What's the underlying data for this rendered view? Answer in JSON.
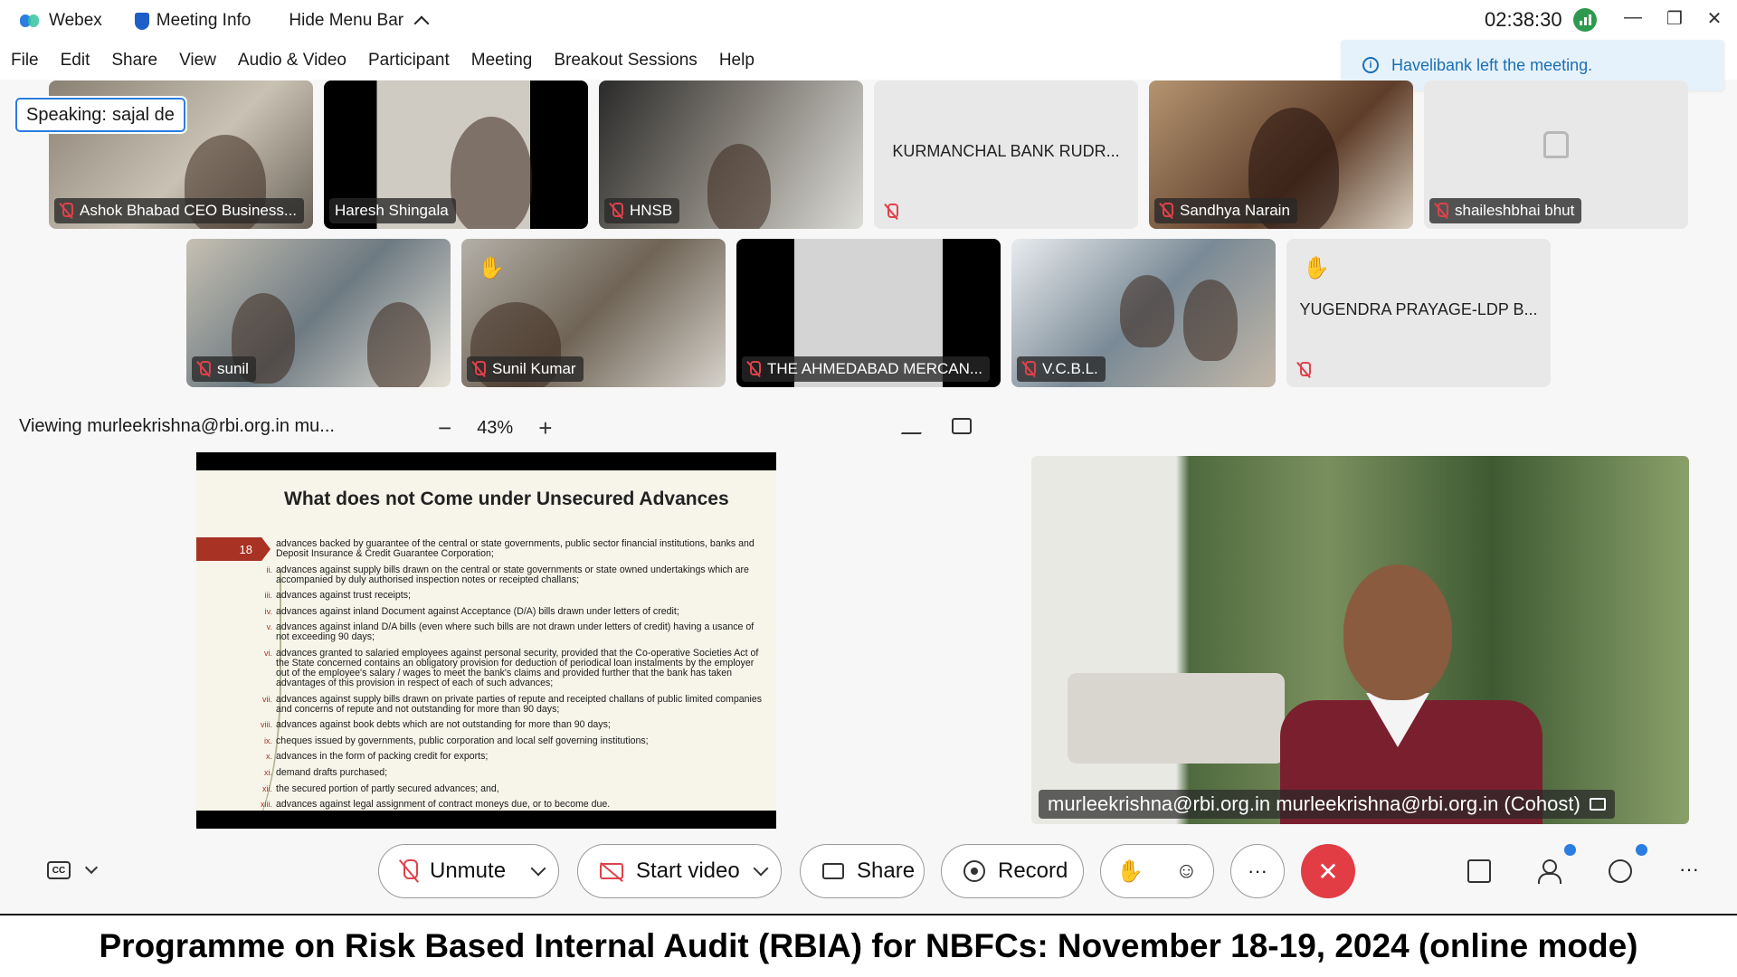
{
  "titlebar": {
    "app_name": "Webex",
    "meeting_info": "Meeting Info",
    "hide_menu": "Hide Menu Bar",
    "clock": "02:38:30"
  },
  "menu": [
    "File",
    "Edit",
    "Share",
    "View",
    "Audio & Video",
    "Participant",
    "Meeting",
    "Breakout Sessions",
    "Help"
  ],
  "toast": {
    "text": "Havelibank left the meeting."
  },
  "speaking": {
    "prefix": "Speaking:",
    "name": "sajal de"
  },
  "participants_row1": [
    {
      "name": "Ashok Bhabad CEO Business...",
      "muted": true
    },
    {
      "name": "Haresh Shingala",
      "muted": false
    },
    {
      "name": "HNSB",
      "muted": true
    },
    {
      "name": "KURMANCHAL BANK RUDR...",
      "muted": true
    },
    {
      "name": "Sandhya Narain",
      "muted": true
    },
    {
      "name": "shaileshbhai bhut",
      "muted": true
    }
  ],
  "participants_row2": [
    {
      "name": "sunil",
      "muted": true
    },
    {
      "name": "Sunil Kumar",
      "muted": true,
      "hand_raised": true
    },
    {
      "name": "THE AHMEDABAD MERCAN...",
      "muted": true
    },
    {
      "name": "V.C.B.L.",
      "muted": true
    },
    {
      "name": "YUGENDRA PRAYAGE-LDP B...",
      "muted": true,
      "hand_raised": true
    }
  ],
  "viewing": {
    "text": "Viewing murleekrishna@rbi.org.in mu...",
    "zoom": "43%",
    "minus": "−",
    "plus": "+"
  },
  "slide": {
    "title": "What does not Come under Unsecured Advances",
    "number": "18",
    "items": [
      {
        "roman": "",
        "text": "advances backed by guarantee of the central or state governments, public sector financial institutions, banks and Deposit Insurance & Credit Guarantee Corporation;"
      },
      {
        "roman": "ii.",
        "text": "advances against supply bills drawn on the central or state governments or state owned undertakings which are accompanied by duly authorised inspection notes or receipted challans;"
      },
      {
        "roman": "iii.",
        "text": "advances against trust receipts;"
      },
      {
        "roman": "iv.",
        "text": "advances against inland Document against Acceptance (D/A) bills drawn under letters of credit;"
      },
      {
        "roman": "v.",
        "text": "advances against inland D/A bills (even where such bills are not drawn under letters of credit) having a usance of not exceeding 90 days;"
      },
      {
        "roman": "vi.",
        "text": "advances granted to salaried employees against personal security, provided that the Co-operative Societies Act of the State concerned contains an obligatory provision for deduction of periodical loan instalments by the employer out of the employee's salary / wages to meet the bank's claims and provided further that the bank has taken advantages of this provision in respect of each of such advances;"
      },
      {
        "roman": "vii.",
        "text": "advances against supply bills drawn on private parties of repute and receipted challans of public limited companies and concerns of repute and not outstanding for more than 90 days;"
      },
      {
        "roman": "viii.",
        "text": "advances against book debts which are not outstanding for more than 90 days;"
      },
      {
        "roman": "ix.",
        "text": "cheques issued by governments, public corporation and local self governing institutions;"
      },
      {
        "roman": "x.",
        "text": "advances in the form of packing credit for exports;"
      },
      {
        "roman": "xi.",
        "text": "demand drafts purchased;"
      },
      {
        "roman": "xii.",
        "text": "the secured portion of partly secured advances; and,"
      },
      {
        "roman": "xiii.",
        "text": "advances against legal assignment of contract moneys due, or to become due."
      }
    ]
  },
  "presenter": {
    "name": "murleekrishna@rbi.org.in murleekrishna@rbi.org.in (Cohost)"
  },
  "controls": {
    "unmute": "Unmute",
    "start_video": "Start video",
    "share": "Share",
    "record": "Record",
    "more": "···",
    "end": "✕",
    "overflow": "···"
  },
  "banner": {
    "text": "Programme on Risk Based Internal Audit (RBIA) for NBFCs: November 18-19, 2024 (online mode)"
  }
}
